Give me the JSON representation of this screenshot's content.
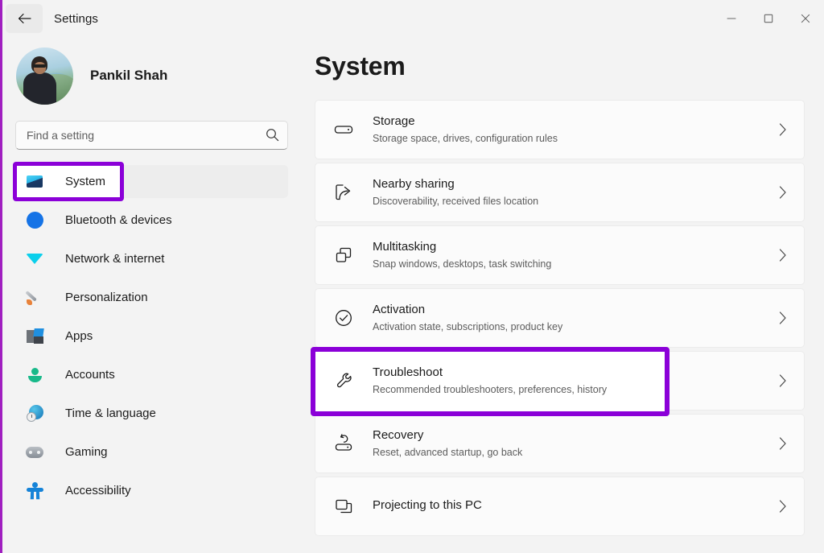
{
  "window": {
    "title": "Settings",
    "back_icon": "back-arrow-icon",
    "controls": {
      "minimize": "minimize-icon",
      "maximize": "maximize-icon",
      "close": "close-icon"
    }
  },
  "sidebar": {
    "profile": {
      "name": "Pankil Shah",
      "avatar": "user-avatar"
    },
    "search": {
      "placeholder": "Find a setting",
      "value": "",
      "icon": "search-icon"
    },
    "items": [
      {
        "label": "System",
        "icon": "monitor-icon",
        "selected": true,
        "annotated": true
      },
      {
        "label": "Bluetooth & devices",
        "icon": "bluetooth-icon",
        "selected": false,
        "annotated": false
      },
      {
        "label": "Network & internet",
        "icon": "wifi-icon",
        "selected": false,
        "annotated": false
      },
      {
        "label": "Personalization",
        "icon": "paintbrush-icon",
        "selected": false,
        "annotated": false
      },
      {
        "label": "Apps",
        "icon": "apps-icon",
        "selected": false,
        "annotated": false
      },
      {
        "label": "Accounts",
        "icon": "account-icon",
        "selected": false,
        "annotated": false
      },
      {
        "label": "Time & language",
        "icon": "clock-globe-icon",
        "selected": false,
        "annotated": false
      },
      {
        "label": "Gaming",
        "icon": "gamepad-icon",
        "selected": false,
        "annotated": false
      },
      {
        "label": "Accessibility",
        "icon": "accessibility-icon",
        "selected": false,
        "annotated": false
      }
    ]
  },
  "main": {
    "page_title": "System",
    "cards": [
      {
        "title": "Storage",
        "subtitle": "Storage space, drives, configuration rules",
        "icon": "drive-icon",
        "annotated": false
      },
      {
        "title": "Nearby sharing",
        "subtitle": "Discoverability, received files location",
        "icon": "share-icon",
        "annotated": false
      },
      {
        "title": "Multitasking",
        "subtitle": "Snap windows, desktops, task switching",
        "icon": "multitasking-icon",
        "annotated": false
      },
      {
        "title": "Activation",
        "subtitle": "Activation state, subscriptions, product key",
        "icon": "check-circle-icon",
        "annotated": false
      },
      {
        "title": "Troubleshoot",
        "subtitle": "Recommended troubleshooters, preferences, history",
        "icon": "wrench-icon",
        "annotated": true
      },
      {
        "title": "Recovery",
        "subtitle": "Reset, advanced startup, go back",
        "icon": "recovery-icon",
        "annotated": false
      },
      {
        "title": "Projecting to this PC",
        "subtitle": "",
        "icon": "projecting-icon",
        "annotated": false
      }
    ],
    "chevron_icon": "chevron-right-icon"
  },
  "annotation": {
    "color": "#8b00d8",
    "edge_color": "#a01fc0"
  }
}
